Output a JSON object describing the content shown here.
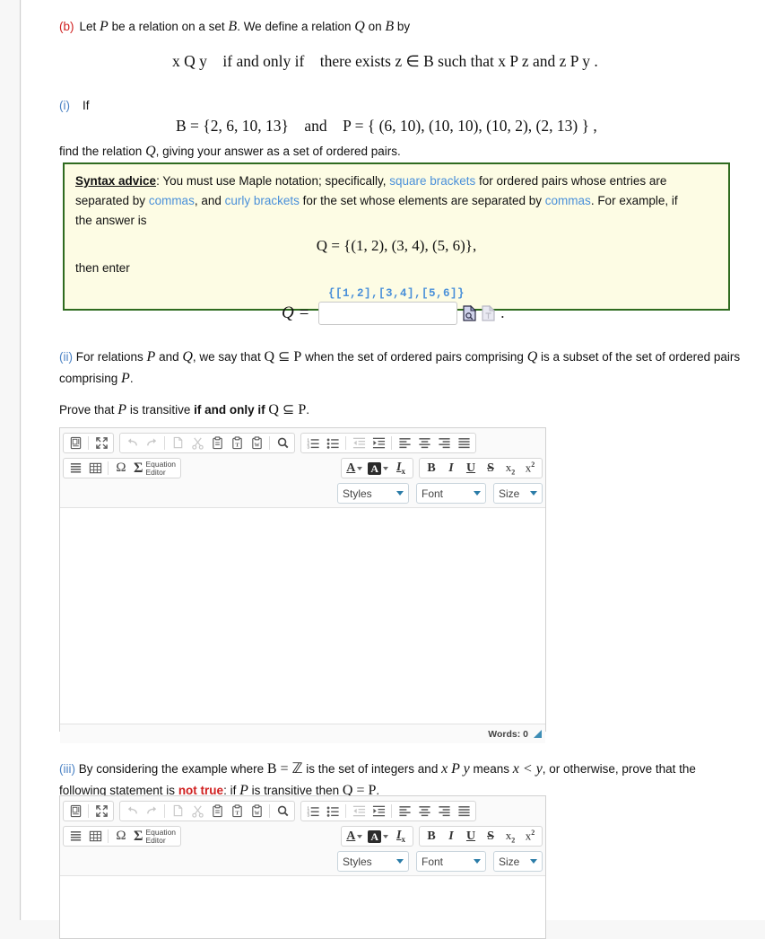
{
  "question": {
    "part_b_label": "(b)",
    "part_b_text_1": "Let ",
    "part_b_P": "P",
    "part_b_text_2": " be a relation on a set ",
    "part_b_B": "B",
    "part_b_text_3": ".  We define a relation ",
    "part_b_Q": "Q",
    "part_b_text_4": " on ",
    "part_b_B2": "B",
    "part_b_text_5": " by",
    "definition_display": "x Q y if and only if there exists z ∈ B such that x P z and z P y .",
    "part_i_label": "(i)",
    "part_i_text": "If",
    "given_display": "B = {2, 6, 10, 13} and P = { (6, 10), (10, 10), (10, 2), (2, 13) } ,",
    "find_text_1": "find the relation ",
    "find_Q": "Q",
    "find_text_2": ", giving your answer as a set of ordered pairs."
  },
  "advice": {
    "title": "Syntax advice",
    "colon": ":",
    "line1_a": "  You must use Maple notation; specifically, ",
    "link1": "square brackets",
    "line1_b": " for ordered pairs whose entries are",
    "line2_a": "separated by ",
    "link2": "commas",
    "line2_b": ", and ",
    "link3": "curly brackets",
    "line2_c": " for the set whose elements are separated by ",
    "link4": "commas",
    "line2_d": ". For example, if",
    "line3": "the answer is",
    "example_equation": "Q = {(1, 2), (3, 4), (5, 6)},",
    "then_enter": "then enter",
    "maple_syntax": "{[1,2],[3,4],[5,6]}"
  },
  "answer": {
    "q_label": "Q =",
    "input_value": "",
    "input_placeholder": "",
    "trailing_period": ".",
    "preview_icon": "document-preview-icon",
    "disabled_icon": "document-disabled-icon"
  },
  "part_ii": {
    "label": "(ii)",
    "text_1": "  For relations ",
    "P": "P",
    "text_2": " and ",
    "Q": "Q",
    "text_3": ", we say that ",
    "subset_expr": "Q ⊆ P",
    "text_4": " when the set of ordered pairs comprising ",
    "Q2": "Q",
    "text_5": " is a subset of the set of ordered pairs comprising ",
    "P2": "P",
    "text_6": ".",
    "prove_1": "Prove that ",
    "prove_P": "P",
    "prove_2": " is transitive ",
    "prove_bold": "if and only if",
    "prove_3": " ",
    "prove_expr": "Q ⊆ P",
    "prove_4": "."
  },
  "part_iii": {
    "label": "(iii)",
    "text_1": "  By considering the example where ",
    "expr_1": "B = ℤ",
    "text_2": " is the set of integers and ",
    "expr_2": "x P y",
    "text_3": " means ",
    "expr_3": "x < y",
    "text_4": ", or otherwise, prove",
    "text_5": "that the following statement is ",
    "not_true": "not true",
    "text_6": ": if ",
    "expr_P": "P",
    "text_7": " is transitive then ",
    "expr_4": "Q = P",
    "text_8": "."
  },
  "editor_toolbar": {
    "group1": [
      {
        "name": "source-icon",
        "title": "Source"
      },
      {
        "name": "maximize-icon",
        "title": "Maximize"
      }
    ],
    "group2": [
      {
        "name": "undo-icon",
        "title": "Undo",
        "disabled": true
      },
      {
        "name": "redo-icon",
        "title": "Redo",
        "disabled": true
      },
      {
        "name": "copy-icon",
        "title": "Copy",
        "disabled": true
      },
      {
        "name": "cut-icon",
        "title": "Cut",
        "disabled": true
      },
      {
        "name": "paste-icon",
        "title": "Paste"
      },
      {
        "name": "paste-text-icon",
        "title": "Paste as plain text"
      },
      {
        "name": "paste-word-icon",
        "title": "Paste from Word"
      },
      {
        "name": "find-icon",
        "title": "Find"
      }
    ],
    "group3": [
      {
        "name": "numbered-list-icon",
        "title": "Insert/Remove Numbered List"
      },
      {
        "name": "bulleted-list-icon",
        "title": "Insert/Remove Bulleted List"
      },
      {
        "name": "outdent-icon",
        "title": "Decrease Indent",
        "disabled": true
      },
      {
        "name": "indent-icon",
        "title": "Increase Indent"
      },
      {
        "name": "align-left-icon",
        "title": "Align Left"
      },
      {
        "name": "align-center-icon",
        "title": "Center"
      },
      {
        "name": "align-right-icon",
        "title": "Align Right"
      },
      {
        "name": "justify-icon",
        "title": "Justify"
      }
    ],
    "group4": [
      {
        "name": "blockquote-icon",
        "title": "Block Quote"
      },
      {
        "name": "table-icon",
        "title": "Table"
      },
      {
        "name": "special-char-icon",
        "title": "Insert Special Character",
        "glyph": "Ω"
      }
    ],
    "equation_editor": {
      "sigma": "Σ",
      "line1": "Equation",
      "line2": "Editor"
    },
    "group5": [
      {
        "name": "text-color-icon",
        "glyph": "A"
      },
      {
        "name": "background-color-icon",
        "glyph": "A"
      },
      {
        "name": "remove-format-icon",
        "glyph": "I",
        "sub": "x"
      }
    ],
    "group6": [
      {
        "name": "bold-icon",
        "glyph": "B"
      },
      {
        "name": "italic-icon",
        "glyph": "I"
      },
      {
        "name": "underline-icon",
        "glyph": "U"
      },
      {
        "name": "strikethrough-icon",
        "glyph": "S"
      },
      {
        "name": "subscript-icon",
        "glyph": "x",
        "script": "2"
      },
      {
        "name": "superscript-icon",
        "glyph": "x",
        "script": "2"
      }
    ],
    "dropdowns": [
      {
        "name": "styles-dropdown",
        "label": "Styles"
      },
      {
        "name": "font-dropdown",
        "label": "Font"
      },
      {
        "name": "size-dropdown",
        "label": "Size"
      }
    ]
  },
  "editor1": {
    "content": "",
    "word_count": "Words: 0"
  },
  "editor2": {
    "content": ""
  },
  "colors": {
    "advice_border": "#2f6b1f",
    "advice_background": "#fdfce4",
    "link_blue": "#4a90d9",
    "label_red": "#d02020",
    "label_blue": "#4a82c4",
    "grip_blue": "#3d8db5"
  }
}
